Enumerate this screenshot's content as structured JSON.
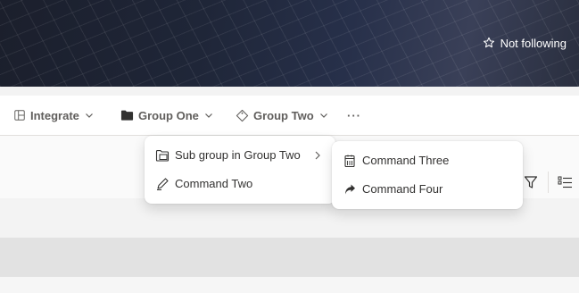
{
  "banner": {
    "follow_label": "Not following"
  },
  "command_bar": {
    "integrate_label": "Integrate",
    "group_one_label": "Group One",
    "group_two_label": "Group Two",
    "more_label": "···"
  },
  "submenu": {
    "items": [
      {
        "label": "Sub group in Group Two",
        "icon": "folder-open-icon",
        "has_children": true
      },
      {
        "label": "Command Two",
        "icon": "edit-icon",
        "has_children": false
      }
    ]
  },
  "nested_menu": {
    "items": [
      {
        "label": "Command Three",
        "icon": "calendar-icon"
      },
      {
        "label": "Command Four",
        "icon": "share-arrow-icon"
      }
    ]
  },
  "colors": {
    "banner_dark": "#1f2638",
    "text_primary": "#323130",
    "text_secondary": "#605e5c",
    "menu_background": "#ffffff"
  }
}
